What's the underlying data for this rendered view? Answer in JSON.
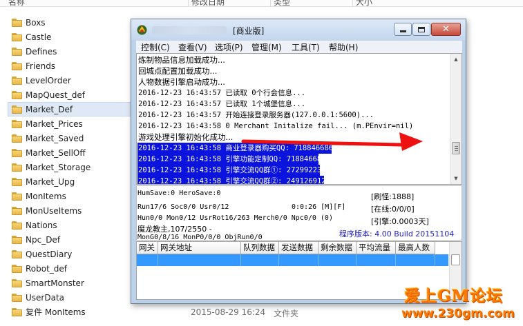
{
  "explorer": {
    "columns": {
      "name": "名称",
      "modified": "修改日期",
      "type": "类型",
      "size": "大小"
    },
    "folders": [
      "Boxs",
      "Castle",
      "Defines",
      "Friends",
      "LevelOrder",
      "MapQuest_def",
      "Market_Def",
      "Market_Prices",
      "Market_Saved",
      "Market_SellOff",
      "Market_Storage",
      "Market_Upg",
      "MonItems",
      "MonUseItems",
      "Nations",
      "Npc_Def",
      "QuestDiary",
      "Robot_def",
      "SmartMonster",
      "UserData",
      "复件 MonItems"
    ],
    "selected_folder": "Market_Def",
    "bottom_row": {
      "date": "2015-08-29 16:24",
      "type": "文件夹"
    }
  },
  "window": {
    "title_suffix": "[商业版]",
    "menu": [
      "控制(C)",
      "查看(V)",
      "选项(P)",
      "管理(M)",
      "工具(T)",
      "帮助(H)"
    ],
    "log_lines": [
      {
        "text": "炼制物品信息加载成功...",
        "hl": false,
        "zh": true
      },
      {
        "text": "回城点配置加载成功...",
        "hl": false,
        "zh": true
      },
      {
        "text": "人物数据引擎启动成功...",
        "hl": false,
        "zh": true
      },
      {
        "text": "2016-12-23 16:43:57 已读取 0个行会信息...",
        "hl": false,
        "zh": false
      },
      {
        "text": "2016-12-23 16:43:57 已读取 1个城堡信息...",
        "hl": false,
        "zh": false
      },
      {
        "text": "2016-12-23 16:43:57 开始连接登录服务器(127.0.0.1:5600)...",
        "hl": false,
        "zh": false
      },
      {
        "text": "2016-12-23 16:43:58 0 Merchant Initalize fail... (m.PEnvir=nil)",
        "hl": false,
        "zh": false
      },
      {
        "text": "游戏处理引擎初始化成功...",
        "hl": false,
        "zh": true
      },
      {
        "text": "2016-12-23 16:43:58 商业登录器购买QQ: 718846686",
        "hl": true,
        "zh": false
      },
      {
        "text": "2016-12-23 16:43:58 引擎功能定制QQ: 718846686",
        "hl": true,
        "zh": false
      },
      {
        "text": "2016-12-23 16:43:58 引擎交流QQ群①: 27299223",
        "hl": true,
        "zh": false
      },
      {
        "text": "2016-12-23 16:43:58 引擎交流QQ群②: 249126912",
        "hl": true,
        "zh": false
      }
    ],
    "status": {
      "save": "HumSave:0 HeroSave:0",
      "run": "Run17/6 Soc0/0 Usr0/12",
      "timer": "0:0:26 [M][F]",
      "hum": "Hun0/0 Mon0/12 UsrRot16/263 Merch0/0 Npc0/0 (0)",
      "boss": "魔龙教主,107/2550 -",
      "mon": "MonG0/8/16 MonP0/0/0 ObjRun0/0",
      "refresh": "[刷怪:1888]",
      "online": "[在线:0/0/0]",
      "engine": "[引擎:0.0003天]",
      "version": "程序版本: 4.00 Build 20151104"
    },
    "grid_columns": [
      "网关",
      "网关地址",
      "队列数据",
      "发送数据",
      "剩余数据",
      "平均流量",
      "最高人数"
    ]
  },
  "watermark": {
    "line1": "爱上GM论坛",
    "line2": "www.230gm.com"
  },
  "colors": {
    "highlight": "#0a14dc",
    "selected_row": "#3399ff",
    "arrow": "#ee1111",
    "watermark": "#ff7a00"
  }
}
